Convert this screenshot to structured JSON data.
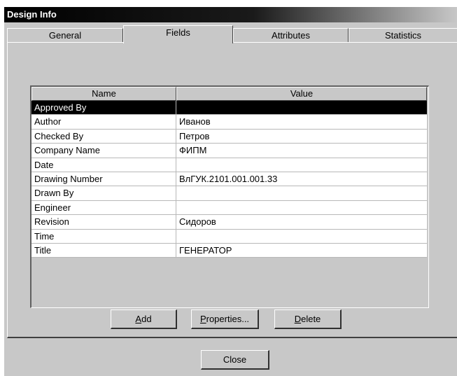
{
  "window": {
    "title": "Design Info"
  },
  "tabs": [
    {
      "label": "General"
    },
    {
      "label": "Fields"
    },
    {
      "label": "Attributes"
    },
    {
      "label": "Statistics"
    }
  ],
  "active_tab": "Fields",
  "table": {
    "columns": [
      "Name",
      "Value"
    ],
    "rows": [
      {
        "name": "Approved By",
        "value": ""
      },
      {
        "name": "Author",
        "value": "Иванов"
      },
      {
        "name": "Checked By",
        "value": "Петров"
      },
      {
        "name": "Company Name",
        "value": "ФИПМ"
      },
      {
        "name": "Date",
        "value": ""
      },
      {
        "name": "Drawing Number",
        "value": "ВлГУК.2101.001.001.33"
      },
      {
        "name": "Drawn By",
        "value": ""
      },
      {
        "name": "Engineer",
        "value": ""
      },
      {
        "name": "Revision",
        "value": "Сидоров"
      },
      {
        "name": "Time",
        "value": ""
      },
      {
        "name": "Title",
        "value": "ГЕНЕРАТОР"
      }
    ],
    "selected_row": "Approved By"
  },
  "buttons": {
    "add": {
      "first": "A",
      "rest": "dd"
    },
    "properties": {
      "first": "P",
      "rest": "roperties..."
    },
    "delete": {
      "first": "D",
      "rest": "elete"
    },
    "close": "Close"
  }
}
